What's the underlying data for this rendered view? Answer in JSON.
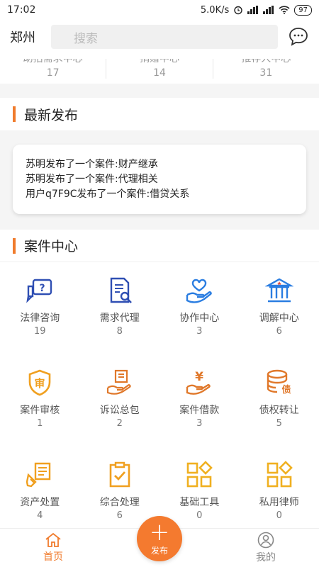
{
  "status_bar": {
    "time": "17:02",
    "speed": "5.0K/s",
    "battery": "97"
  },
  "header": {
    "city": "郑州",
    "search_placeholder": "搜索"
  },
  "stats": [
    {
      "label": "助拍需求中心",
      "value": "17"
    },
    {
      "label": "捐赠中心",
      "value": "14"
    },
    {
      "label": "推荐人中心",
      "value": "31"
    }
  ],
  "latest": {
    "title": "最新发布",
    "items": [
      "苏明发布了一个案件:财产继承",
      "苏明发布了一个案件:代理相关",
      "用户q7F9C发布了一个案件:借贷关系"
    ]
  },
  "case_center": {
    "title": "案件中心",
    "items": [
      {
        "label": "法律咨询",
        "count": "19",
        "icon": "legal-consult-icon",
        "color": "#2f4fb3"
      },
      {
        "label": "需求代理",
        "count": "8",
        "icon": "document-search-icon",
        "color": "#2f4fb3"
      },
      {
        "label": "协作中心",
        "count": "3",
        "icon": "heart-hand-icon",
        "color": "#2a7de1"
      },
      {
        "label": "调解中心",
        "count": "6",
        "icon": "court-building-icon",
        "color": "#2a7de1"
      },
      {
        "label": "案件审核",
        "count": "1",
        "icon": "shield-review-icon",
        "color": "#f0a020"
      },
      {
        "label": "诉讼总包",
        "count": "2",
        "icon": "hand-document-icon",
        "color": "#e0782a"
      },
      {
        "label": "案件借款",
        "count": "3",
        "icon": "yuan-hand-icon",
        "color": "#e0782a"
      },
      {
        "label": "债权转让",
        "count": "5",
        "icon": "debt-coins-icon",
        "color": "#e0782a"
      },
      {
        "label": "资产处置",
        "count": "4",
        "icon": "asset-paper-icon",
        "color": "#f0a020"
      },
      {
        "label": "综合处理",
        "count": "6",
        "icon": "clipboard-check-icon",
        "color": "#f0a020"
      },
      {
        "label": "基础工具",
        "count": "0",
        "icon": "grid-tools-icon",
        "color": "#f0b020"
      },
      {
        "label": "私用律师",
        "count": "0",
        "icon": "grid-lawyer-icon",
        "color": "#f0b020"
      }
    ]
  },
  "tabbar": {
    "home": "首页",
    "publish": "发布",
    "mine": "我的",
    "accent": "#f07b2c"
  }
}
